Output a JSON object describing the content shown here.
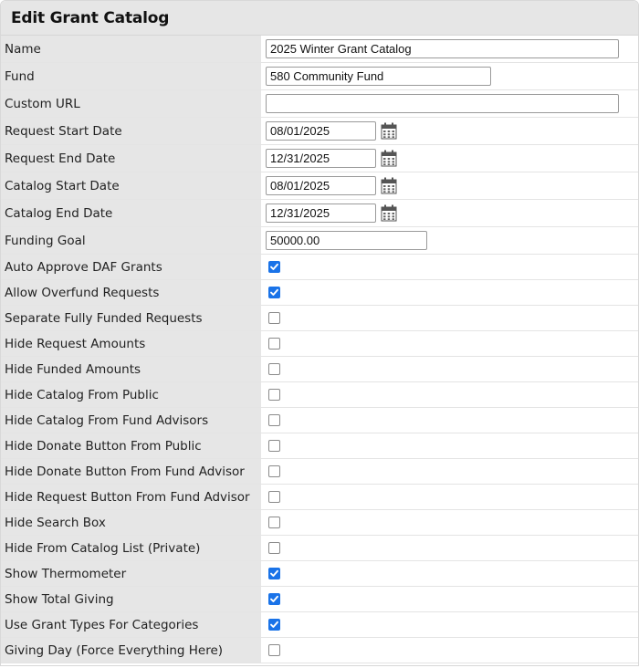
{
  "title": "Edit Grant Catalog",
  "text_fields": [
    {
      "label": "Name",
      "value": "2025 Winter Grant Catalog"
    },
    {
      "label": "Fund",
      "value": "580 Community Fund"
    },
    {
      "label": "Custom URL",
      "value": ""
    }
  ],
  "date_fields": [
    {
      "label": "Request Start Date",
      "value": "08/01/2025"
    },
    {
      "label": "Request End Date",
      "value": "12/31/2025"
    },
    {
      "label": "Catalog Start Date",
      "value": "08/01/2025"
    },
    {
      "label": "Catalog End Date",
      "value": "12/31/2025"
    }
  ],
  "funding_goal": {
    "label": "Funding Goal",
    "value": "50000.00"
  },
  "checkboxes": [
    {
      "label": "Auto Approve DAF Grants",
      "checked": true
    },
    {
      "label": "Allow Overfund Requests",
      "checked": true
    },
    {
      "label": "Separate Fully Funded Requests",
      "checked": false
    },
    {
      "label": "Hide Request Amounts",
      "checked": false
    },
    {
      "label": "Hide Funded Amounts",
      "checked": false
    },
    {
      "label": "Hide Catalog From Public",
      "checked": false
    },
    {
      "label": "Hide Catalog From Fund Advisors",
      "checked": false
    },
    {
      "label": "Hide Donate Button From Public",
      "checked": false
    },
    {
      "label": "Hide Donate Button From Fund Advisor",
      "checked": false
    },
    {
      "label": "Hide Request Button From Fund Advisor",
      "checked": false
    },
    {
      "label": "Hide Search Box",
      "checked": false
    },
    {
      "label": "Hide From Catalog List (Private)",
      "checked": false
    },
    {
      "label": "Show Thermometer",
      "checked": true
    },
    {
      "label": "Show Total Giving",
      "checked": true
    },
    {
      "label": "Use Grant Types For Categories",
      "checked": true
    },
    {
      "label": "Giving Day (Force Everything Here)",
      "checked": false
    }
  ],
  "icons": {
    "date_picker": "calendar-icon",
    "checkmark": "checkmark-icon"
  },
  "colors": {
    "header_bg": "#e6e6e6",
    "checkbox_checked": "#1a73e8"
  }
}
